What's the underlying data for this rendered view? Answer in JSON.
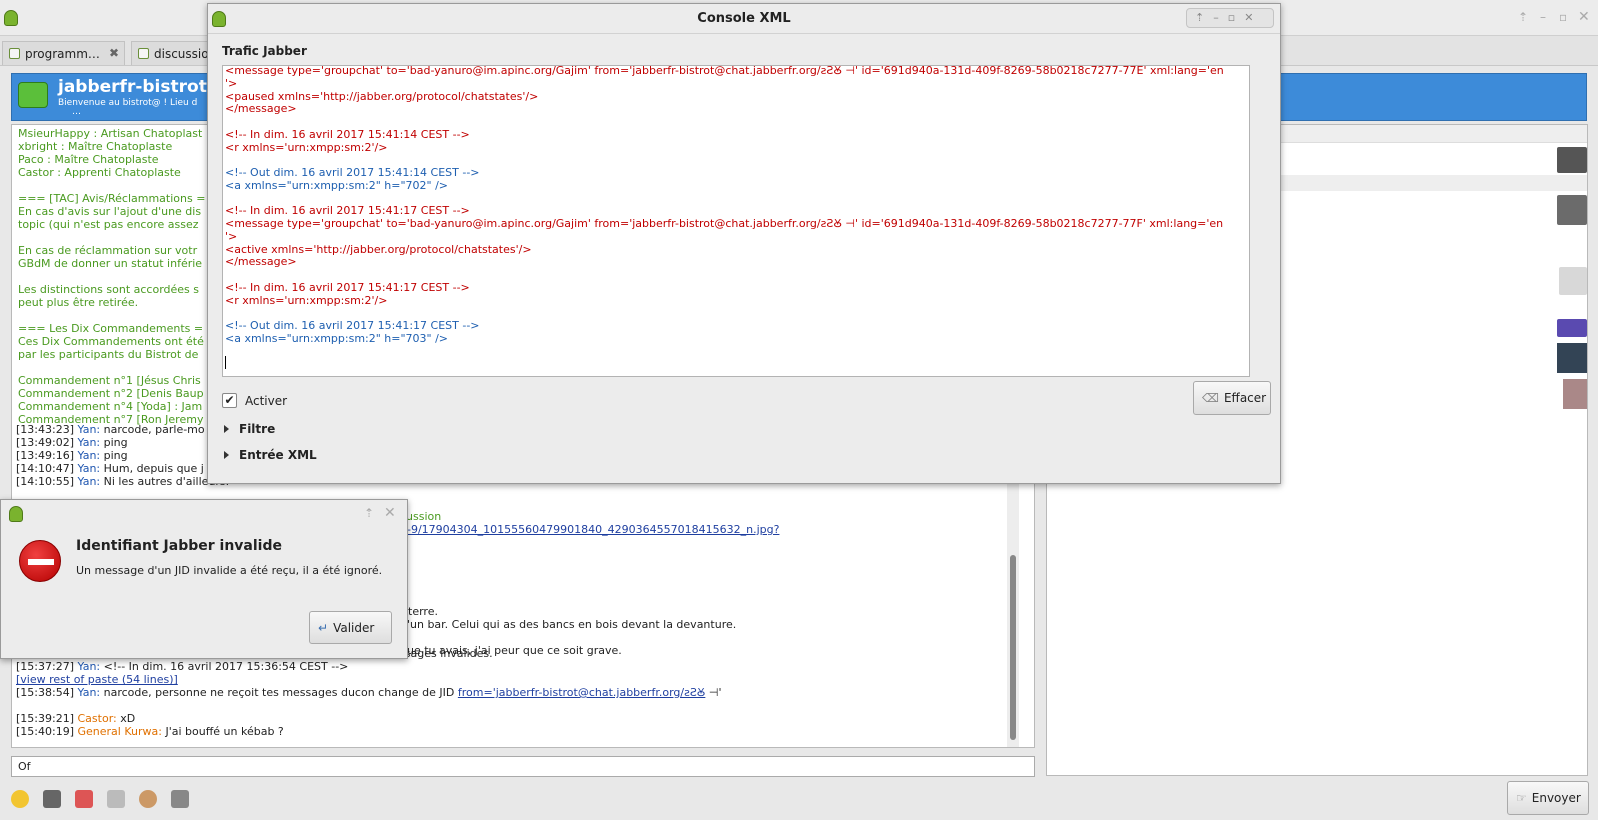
{
  "main": {
    "tabs": [
      {
        "label": "programm…"
      },
      {
        "label": "discussio"
      }
    ],
    "room_name": "jabberfr-bistrot@c",
    "room_subject": "Bienvenue au bistrot@ ! Lieu d",
    "room_subject2": "…"
  },
  "chat_lines": [
    {
      "t": "MsieurHappy : Artisan Chatoplast",
      "c": "g"
    },
    {
      "t": "xbright : Maître Chatoplaste",
      "c": "g"
    },
    {
      "t": "Paco : Maître Chatoplaste",
      "c": "g"
    },
    {
      "t": "Castor : Apprenti Chatoplaste",
      "c": "g"
    },
    {
      "t": "",
      "c": "g"
    },
    {
      "t": "=== [TAC] Avis/Réclammations =",
      "c": "g"
    },
    {
      "t": "En cas d'avis sur l'ajout d'une dis",
      "c": "g"
    },
    {
      "t": "topic (qui n'est pas encore assez",
      "c": "g"
    },
    {
      "t": "",
      "c": "g"
    },
    {
      "t": "En cas de réclammation sur votr",
      "c": "g"
    },
    {
      "t": "GBdM de donner un statut inférie",
      "c": "g"
    },
    {
      "t": "",
      "c": "g"
    },
    {
      "t": "Les distinctions sont accordées s",
      "c": "g"
    },
    {
      "t": "peut plus être retirée.",
      "c": "g"
    },
    {
      "t": "",
      "c": "g"
    },
    {
      "t": "=== Les Dix Commandements =",
      "c": "g"
    },
    {
      "t": "Ces Dix Commandements ont été",
      "c": "g"
    },
    {
      "t": "par les participants du Bistrot de",
      "c": "g"
    },
    {
      "t": "",
      "c": "g"
    },
    {
      "t": "Commandement n°1 [Jésus Chris",
      "c": "g"
    },
    {
      "t": "Commandement n°2 [Denis Baup",
      "c": "g"
    },
    {
      "t": "Commandement n°4 [Yoda] : Jam",
      "c": "g"
    },
    {
      "t": "Commandement n°7 [Ron Jeremy",
      "c": "g"
    }
  ],
  "chat_msgs": [
    {
      "time": "[13:43:23]",
      "nick": "Yan:",
      "text": "narcode, parle-mo",
      "nc": "b"
    },
    {
      "time": "[13:49:02]",
      "nick": "Yan:",
      "text": "ping",
      "nc": "b"
    },
    {
      "time": "[13:49:16]",
      "nick": "Yan:",
      "text": "ping",
      "nc": "b"
    },
    {
      "time": "[14:10:47]",
      "nick": "Yan:",
      "text": "Hum, depuis que j",
      "nc": "b"
    },
    {
      "time": "[14:10:55]",
      "nick": "Yan:",
      "text": "Ni les autres d'ailleurs.",
      "nc": "b"
    }
  ],
  "chat_fragments": {
    "discussion": "cussion",
    "link": "0-9/17904304_10155560479901840_4290364557018415632_n.jpg?",
    "terre": "r terre.",
    "bar": "d'un bar. Celui qui as des bancs en bois devant la devanture.",
    "grave": "que tu avais, j'ai peur que ce soit grave."
  },
  "chat_bottom": [
    {
      "time": "[15:35:09]",
      "nick": "Yan:",
      "text": "narcode, fais quelque chose, on ne reçoit que des messages invalides.",
      "nc": "b"
    },
    {
      "time": "[15:37:27]",
      "nick": "Yan:",
      "text": "<!-- In dim. 16 avril 2017 15:36:54 CEST -->",
      "nc": "b"
    },
    {
      "time": "",
      "nick": "",
      "text": "[view rest of paste (54 lines)]",
      "nc": "lk"
    },
    {
      "time": "[15:38:54]",
      "nick": "Yan:",
      "text": "narcode, personne ne reçoit tes messages ducon change de JID",
      "nc": "b",
      "link": "from='jabberfr-bistrot@chat.jabberfr.org/ꙅꙄꙊ",
      "tail": " ⊣'"
    },
    {
      "time": "[15:39:21]",
      "nick": "Castor:",
      "text": "xD",
      "nc": "o"
    },
    {
      "time": "[15:40:19]",
      "nick": "General Kurwa:",
      "text": "J'ai bouffé un kébab ?",
      "nc": "o"
    }
  ],
  "input": {
    "value": "Of"
  },
  "send_label": "Envoyer",
  "console": {
    "title": "Console XML",
    "section": "Trafic Jabber",
    "activate_label": "Activer",
    "clear_label": "Effacer",
    "filter_label": "Filtre",
    "xml_input_label": "Entrée XML",
    "lines": [
      {
        "t": "<message type='groupchat' to='bad-yanuro@im.apinc.org/Gajim' from='jabberfr-bistrot@chat.jabberfr.org/ꙅꙄꙊ ⊣' id='691d940a-131d-409f-8269-58b0218c7277-77E' xml:lang='en",
        "c": "r"
      },
      {
        "t": "'>",
        "c": "r"
      },
      {
        "t": "<paused xmlns='http://jabber.org/protocol/chatstates'/>",
        "c": "r"
      },
      {
        "t": "</message>",
        "c": "r"
      },
      {
        "t": "",
        "c": "r"
      },
      {
        "t": "<!-- In dim. 16 avril 2017 15:41:14 CEST -->",
        "c": "r"
      },
      {
        "t": "<r xmlns='urn:xmpp:sm:2'/>",
        "c": "r"
      },
      {
        "t": "",
        "c": "r"
      },
      {
        "t": "<!-- Out dim. 16 avril 2017 15:41:14 CEST -->",
        "c": "bl"
      },
      {
        "t": "<a xmlns=\"urn:xmpp:sm:2\" h=\"702\" />",
        "c": "bl"
      },
      {
        "t": "",
        "c": "r"
      },
      {
        "t": "<!-- In dim. 16 avril 2017 15:41:17 CEST -->",
        "c": "r"
      },
      {
        "t": "<message type='groupchat' to='bad-yanuro@im.apinc.org/Gajim' from='jabberfr-bistrot@chat.jabberfr.org/ꙅꙄꙊ ⊣' id='691d940a-131d-409f-8269-58b0218c7277-77F' xml:lang='en",
        "c": "r"
      },
      {
        "t": "'>",
        "c": "r"
      },
      {
        "t": "<active xmlns='http://jabber.org/protocol/chatstates'/>",
        "c": "r"
      },
      {
        "t": "</message>",
        "c": "r"
      },
      {
        "t": "",
        "c": "r"
      },
      {
        "t": "<!-- In dim. 16 avril 2017 15:41:17 CEST -->",
        "c": "r"
      },
      {
        "t": "<r xmlns='urn:xmpp:sm:2'/>",
        "c": "r"
      },
      {
        "t": "",
        "c": "r"
      },
      {
        "t": "<!-- Out dim. 16 avril 2017 15:41:17 CEST -->",
        "c": "bl"
      },
      {
        "t": "<a xmlns=\"urn:xmpp:sm:2\" h=\"703\" />",
        "c": "bl"
      }
    ]
  },
  "dialog": {
    "title": "Identifiant Jabber invalide",
    "message": "Un message d'un JID invalide a été reçu, il a été ignoré.",
    "ok_label": "Valider"
  }
}
